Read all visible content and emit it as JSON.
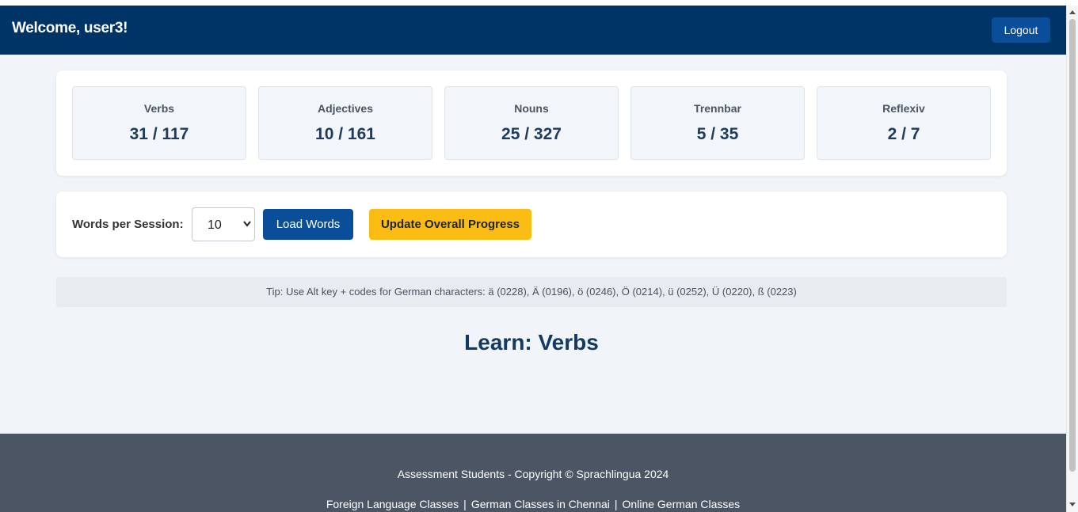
{
  "header": {
    "welcome": "Welcome, user3!",
    "logout_label": "Logout"
  },
  "stats": [
    {
      "label": "Verbs",
      "value": "31 / 117"
    },
    {
      "label": "Adjectives",
      "value": "10 / 161"
    },
    {
      "label": "Nouns",
      "value": "25 / 327"
    },
    {
      "label": "Trennbar",
      "value": "5 / 35"
    },
    {
      "label": "Reflexiv",
      "value": "2 / 7"
    }
  ],
  "controls": {
    "words_per_session_label": "Words per Session:",
    "words_per_session_value": "10",
    "load_words_label": "Load Words",
    "update_progress_label": "Update Overall Progress"
  },
  "tip": "Tip: Use Alt key + codes for German characters: ä (0228), Ä (0196), ö (0246), Ö (0214), ü (0252), Ü (0220), ß (0223)",
  "learn_title": "Learn: Verbs",
  "footer": {
    "copyright": "Assessment Students - Copyright © Sprachlingua 2024",
    "links": [
      "Foreign Language Classes",
      "German Classes in Chennai",
      "Online German Classes"
    ],
    "separator": "|"
  },
  "colors": {
    "header_bg": "#003366",
    "primary_button": "#0a4d99",
    "accent_button": "#fbbc14",
    "footer_bg": "#4b5563",
    "page_bg": "#f1f5f9"
  }
}
